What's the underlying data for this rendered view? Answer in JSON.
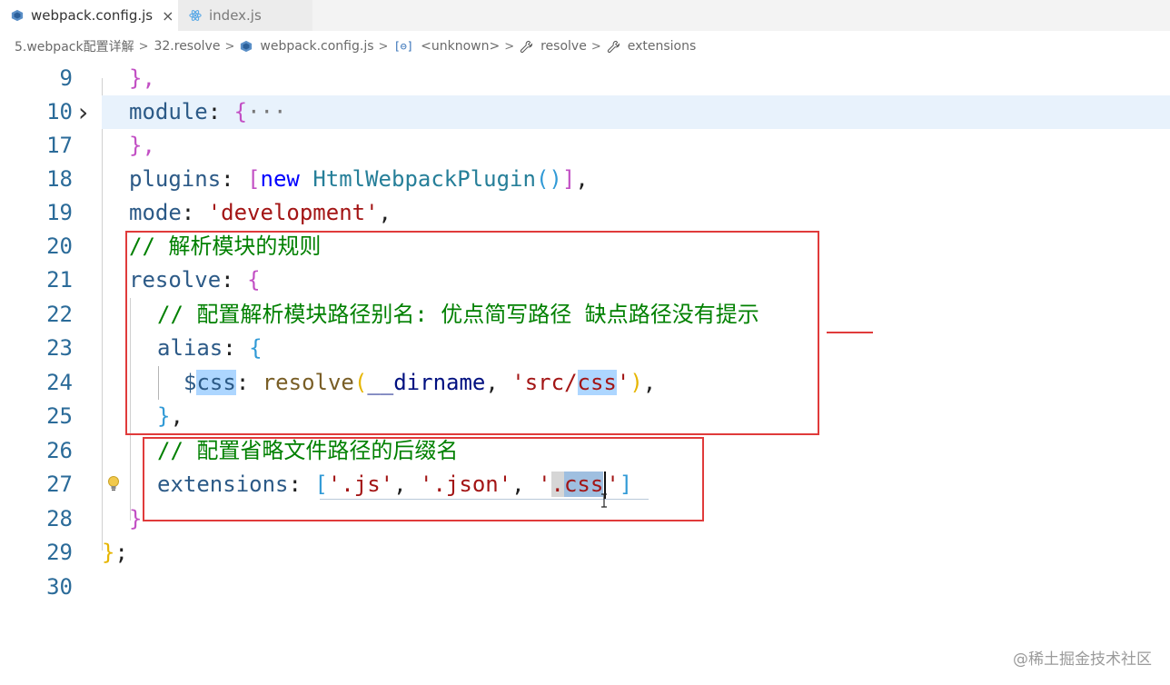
{
  "tabs": [
    {
      "label": "webpack.config.js",
      "active": true,
      "close": "×"
    },
    {
      "label": "index.js",
      "active": false
    }
  ],
  "breadcrumb": {
    "items": [
      "5.webpack配置详解",
      "32.resolve",
      "webpack.config.js",
      "<unknown>",
      "resolve",
      "extensions"
    ],
    "separator": ">"
  },
  "editor": {
    "lines": [
      {
        "n": "9"
      },
      {
        "n": "10"
      },
      {
        "n": "17"
      },
      {
        "n": "18"
      },
      {
        "n": "19"
      },
      {
        "n": "20"
      },
      {
        "n": "21"
      },
      {
        "n": "22"
      },
      {
        "n": "23"
      },
      {
        "n": "24"
      },
      {
        "n": "25"
      },
      {
        "n": "26"
      },
      {
        "n": "27"
      },
      {
        "n": "28"
      },
      {
        "n": "29"
      },
      {
        "n": "30"
      }
    ],
    "fold_marker": "›",
    "collapsed_ellipsis": "···",
    "code": {
      "l9_close": "},",
      "l10_module": "module",
      "l10_colon": ": ",
      "l10_brace": "{",
      "l17_close": "},",
      "l18_plugins": "plugins",
      "l18_colon": ": ",
      "l18_open": "[",
      "l18_new": "new ",
      "l18_cls": "HtmlWebpackPlugin",
      "l18_parens": "()",
      "l18_close": "]",
      "l18_comma": ",",
      "l19_mode": "mode",
      "l19_colon": ": ",
      "l19_value": "'development'",
      "l19_comma": ",",
      "l20_comment": "// 解析模块的规则",
      "l21_resolve": "resolve",
      "l21_colon": ": ",
      "l21_brace": "{",
      "l22_comment": "// 配置解析模块路径别名: 优点简写路径 缺点路径没有提示",
      "l23_alias": "alias",
      "l23_colon": ": ",
      "l23_brace": "{",
      "l24_dollar": "$",
      "l24_css": "css",
      "l24_colon": ": ",
      "l24_fn": "resolve",
      "l24_open": "(",
      "l24_dirname": "__dirname",
      "l24_comma": ", ",
      "l24_str_a": "'src/",
      "l24_str_b": "css",
      "l24_str_c": "'",
      "l24_close": ")",
      "l24_end": ",",
      "l25_close": "}",
      "l25_comma": ",",
      "l26_comment": "// 配置省略文件路径的后缀名",
      "l27_ext": "extensions",
      "l27_colon": ": ",
      "l27_open": "[",
      "l27_js": "'.js'",
      "l27_c1": ", ",
      "l27_json": "'.json'",
      "l27_c2": ", ",
      "l27_q1": "'",
      "l27_dot": ".",
      "l27_css": "css",
      "l27_q2": "'",
      "l27_close": "]",
      "l28_close": "}",
      "l29_close": "}",
      "l29_semi": ";"
    }
  },
  "colors": {
    "keyword": "#0000ff",
    "property": "#2c5a87",
    "string": "#a31515",
    "comment": "#008000",
    "annotation_red": "#e03b3b",
    "line_number": "#2b6b99"
  },
  "icons": {
    "file_tab": "webpack-cube-icon",
    "index_tab": "react-atom-icon",
    "lightbulb": "lightbulb-icon"
  },
  "watermark": "@稀土掘金技术社区"
}
